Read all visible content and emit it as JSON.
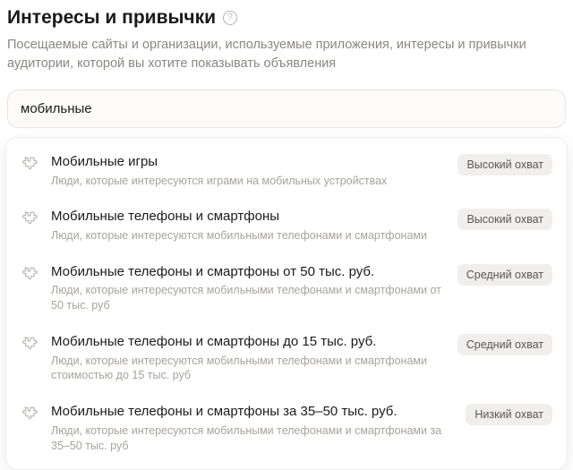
{
  "header": {
    "title": "Интересы и привычки",
    "help_icon": "?",
    "subtitle": "Посещаемые сайты и организации, используемые приложения, интересы и привычки аудитории, которой вы хотите показывать объявления"
  },
  "search": {
    "value": "мобильные"
  },
  "reach_labels": {
    "high": "Высокий охват",
    "medium": "Средний охват",
    "low": "Низкий охват"
  },
  "suggestions": [
    {
      "icon": "puzzle-icon",
      "title": "Мобильные игры",
      "desc": "Люди, которые интересуются играми на мобильных устройствах",
      "reach": "Высокий охват"
    },
    {
      "icon": "puzzle-icon",
      "title": "Мобильные телефоны и смартфоны",
      "desc": "Люди, которые интересуются мобильными телефонами и смартфонами",
      "reach": "Высокий охват"
    },
    {
      "icon": "puzzle-icon",
      "title": "Мобильные телефоны и смартфоны от 50 тыс. руб.",
      "desc": "Люди, которые интересуются мобильными телефонами и смартфонами от 50 тыс. руб",
      "reach": "Средний охват"
    },
    {
      "icon": "puzzle-icon",
      "title": "Мобильные телефоны и смартфоны до 15 тыс. руб.",
      "desc": "Люди, которые интересуются мобильными телефонами и смартфонами стоимостью до 15 тыс. руб",
      "reach": "Средний охват"
    },
    {
      "icon": "puzzle-icon",
      "title": "Мобильные телефоны и смартфоны за 35–50 тыс. руб.",
      "desc": "Люди, которые интересуются мобильными телефонами и смартфонами за 35–50 тыс. руб",
      "reach": "Низкий охват"
    }
  ]
}
